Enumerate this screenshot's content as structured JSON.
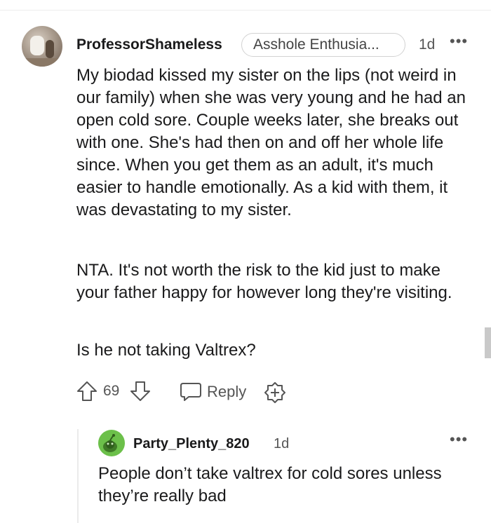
{
  "comment": {
    "username": "ProfessorShameless",
    "flair": "Asshole Enthusia...",
    "time": "1d",
    "more": "•••",
    "paragraphs": [
      "My biodad kissed my sister on the lips (not weird in our family) when she was very young and he had an open cold sore. Couple weeks later, she breaks out with one. She's had then on and off her whole life since. When you get them as an adult, it's much easier to handle emotionally. As a kid with them, it was devastating to my sister.",
      "NTA. It's not worth the risk to the kid just to make your father happy for however long they're visiting.",
      "Is he not taking Valtrex?"
    ],
    "score": "69",
    "reply_label": "Reply"
  },
  "reply": {
    "username": "Party_Plenty_820",
    "time": "1d",
    "more": "•••",
    "text": "People don’t take valtrex for cold sores unless they’re really bad"
  },
  "colors": {
    "text": "#1a1a1b",
    "meta": "#555555",
    "reply_avatar": "#6cc04a"
  }
}
